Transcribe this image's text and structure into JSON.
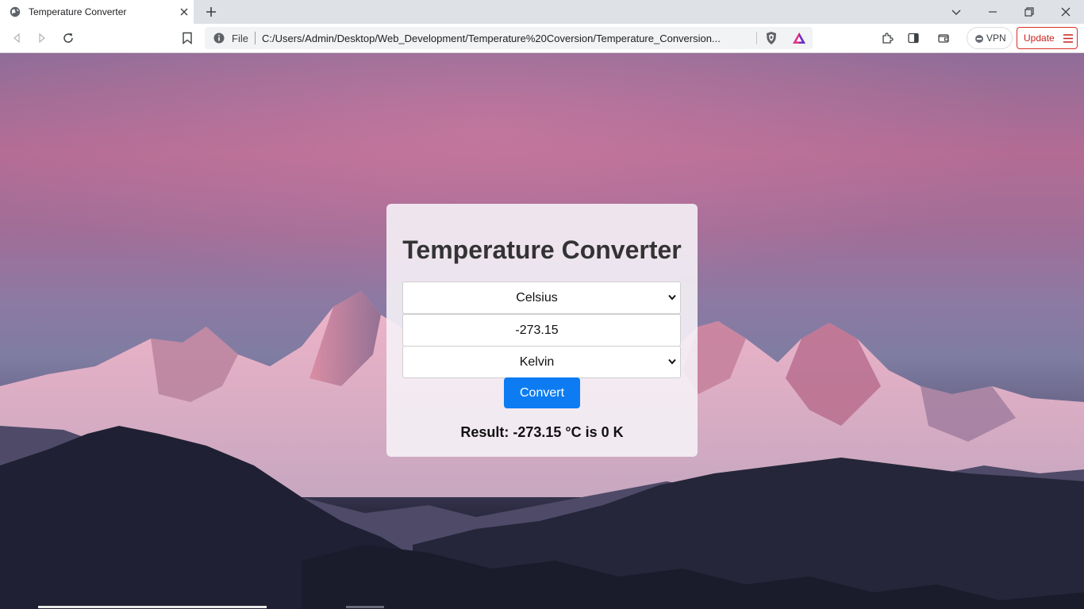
{
  "browser": {
    "tab": {
      "title": "Temperature Converter",
      "favicon": "globe-icon"
    },
    "new_tab_icon": "plus-icon",
    "window_controls": [
      "tab-search-icon",
      "minimize-icon",
      "restore-icon",
      "close-icon"
    ],
    "omnibox": {
      "scheme": "File",
      "url": "C:/Users/Admin/Desktop/Web_Development/Temperature%20Coversion/Temperature_Conversion..."
    },
    "vpn_label": "VPN",
    "update_label": "Update"
  },
  "converter": {
    "title": "Temperature Converter",
    "from_unit": "Celsius",
    "input_value": "-273.15",
    "to_unit": "Kelvin",
    "convert_label": "Convert",
    "result": "Result: -273.15 °C is 0 K"
  },
  "colors": {
    "button": "#0d7cf2",
    "update_border": "#d93025"
  }
}
